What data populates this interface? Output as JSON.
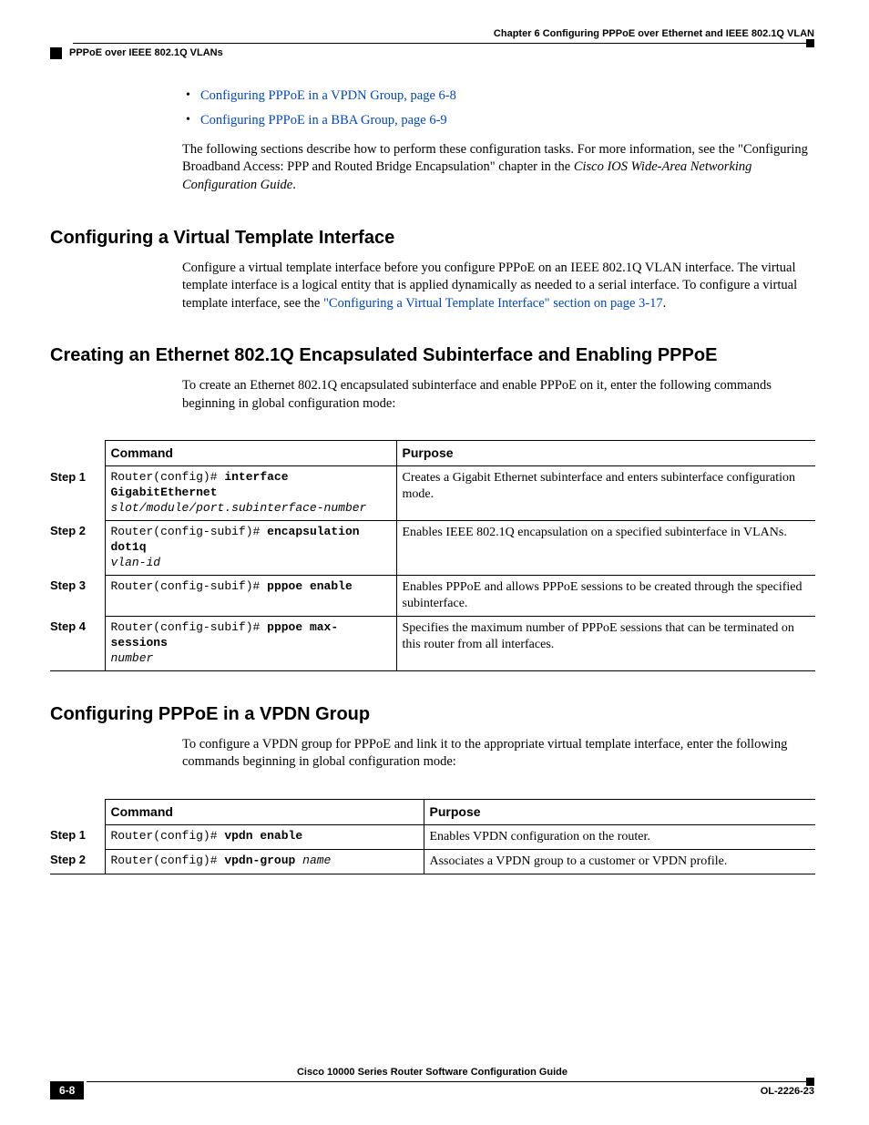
{
  "header": {
    "chapter": "Chapter 6      Configuring PPPoE over Ethernet and IEEE 802.1Q VLAN",
    "section": "PPPoE over IEEE 802.1Q VLANs"
  },
  "intro": {
    "bullet1": "Configuring PPPoE in a VPDN Group, page 6-8",
    "bullet2": "Configuring PPPoE in a BBA Group, page 6-9",
    "para_a": "The following sections describe how to perform these configuration tasks. For more information, see the \"Configuring Broadband Access: PPP and Routed Bridge Encapsulation\" chapter in the ",
    "para_b": "Cisco IOS Wide-Area Networking Configuration Guide",
    "para_c": "."
  },
  "h2_1": "Configuring a Virtual Template Interface",
  "vt": {
    "para_a": "Configure a virtual template interface before you configure PPPoE on an IEEE 802.1Q VLAN interface. The virtual template interface is a logical entity that is applied dynamically as needed to a serial interface. To configure a virtual template interface, see the ",
    "link": "\"Configuring a Virtual Template Interface\" section on page 3-17",
    "para_c": "."
  },
  "h2_2": "Creating an Ethernet 802.1Q Encapsulated Subinterface and Enabling PPPoE",
  "sub": {
    "para": "To create an Ethernet 802.1Q encapsulated subinterface and enable PPPoE on it, enter the following commands beginning in global configuration mode:"
  },
  "table1": {
    "h_command": "Command",
    "h_purpose": "Purpose",
    "rows": [
      {
        "step": "Step 1",
        "prompt": "Router(config)# ",
        "bold": "interface GigabitEthernet",
        "italic": "slot/module/port.subinterface-number",
        "purpose": "Creates a Gigabit Ethernet subinterface and enters subinterface configuration mode."
      },
      {
        "step": "Step 2",
        "prompt": "Router(config-subif)# ",
        "bold": "encapsulation dot1q",
        "italic": "vlan-id",
        "purpose": "Enables IEEE 802.1Q encapsulation on a specified subinterface in VLANs."
      },
      {
        "step": "Step 3",
        "prompt": "Router(config-subif)# ",
        "bold": "pppoe enable",
        "italic": "",
        "purpose": "Enables PPPoE and allows PPPoE sessions to be created through the specified subinterface."
      },
      {
        "step": "Step 4",
        "prompt": "Router(config-subif)# ",
        "bold": "pppoe max-sessions",
        "italic": "number",
        "purpose": "Specifies the maximum number of PPPoE sessions that can be terminated on this router from all interfaces."
      }
    ]
  },
  "h2_3": "Configuring PPPoE in a VPDN Group",
  "vpdn": {
    "para": "To configure a VPDN group for PPPoE and link it to the appropriate virtual template interface, enter the following commands beginning in global configuration mode:"
  },
  "table2": {
    "h_command": "Command",
    "h_purpose": "Purpose",
    "rows": [
      {
        "step": "Step 1",
        "prompt": "Router(config)# ",
        "bold": "vpdn enable",
        "italic": "",
        "purpose": "Enables VPDN configuration on the router."
      },
      {
        "step": "Step 2",
        "prompt": "Router(config)# ",
        "bold": "vpdn-group ",
        "italic": "name",
        "purpose": "Associates a VPDN group to a customer or VPDN profile."
      }
    ]
  },
  "footer": {
    "title": "Cisco 10000 Series Router Software Configuration Guide",
    "page": "6-8",
    "docid": "OL-2226-23"
  }
}
